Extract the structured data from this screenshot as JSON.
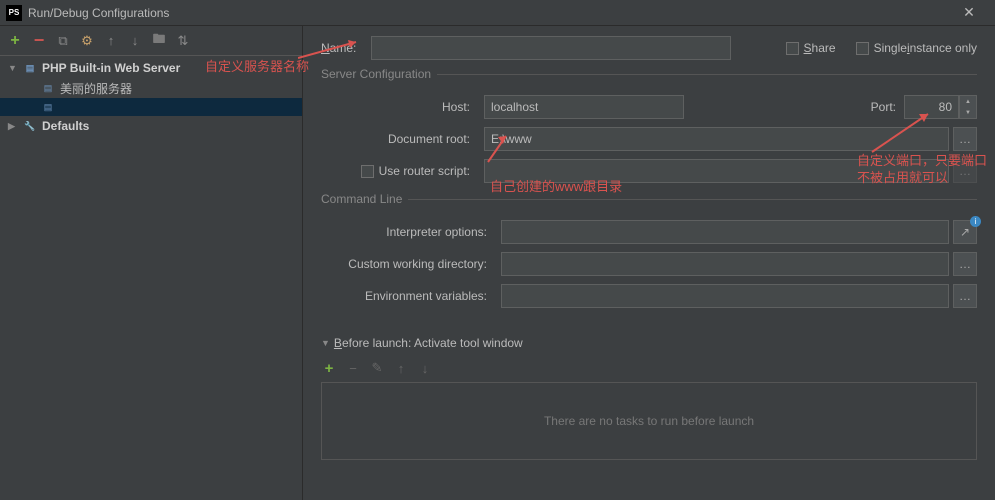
{
  "window": {
    "title": "Run/Debug Configurations"
  },
  "toolbar": {
    "add": "+",
    "remove": "−",
    "copy": "⧉",
    "settings": "⚙",
    "up": "↑",
    "down": "↓",
    "folder": "📁",
    "sort": "↕"
  },
  "tree": {
    "items": [
      {
        "label": "PHP Built-in Web Server",
        "children": [
          {
            "label": "美丽的服务器"
          },
          {
            "label": ""
          }
        ]
      },
      {
        "label": "Defaults"
      }
    ]
  },
  "form": {
    "name_label": "Name:",
    "name_value": "",
    "share_label": "Share",
    "single_instance_label": "Single instance only",
    "server_config_header": "Server Configuration",
    "host_label": "Host:",
    "host_value": "localhost",
    "port_label": "Port:",
    "port_value": "80",
    "doc_root_label": "Document root:",
    "doc_root_value": "E:\\www",
    "router_label": "Use router script:",
    "command_line_header": "Command Line",
    "interp_label": "Interpreter options:",
    "cwdir_label": "Custom working directory:",
    "env_label": "Environment variables:",
    "before_launch_header": "Before launch: Activate tool window",
    "before_launch_empty": "There are no tasks to run before launch"
  },
  "annotations": {
    "name": "自定义服务器名称",
    "docroot": "自己创建的www跟目录",
    "port": "自定义端口，只要端口不被占用就可以"
  }
}
